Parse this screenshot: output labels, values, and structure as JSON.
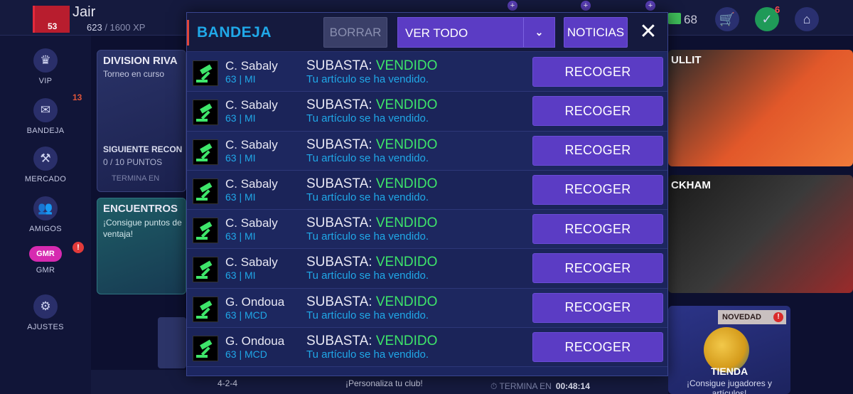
{
  "player": {
    "name": "Jair",
    "level": "53",
    "xp_current": "623",
    "xp_total": "1600",
    "xp_unit": "XP"
  },
  "currency": {
    "value": "68"
  },
  "header_icons": {
    "notifications_badge": "6"
  },
  "sidebar": {
    "items": [
      {
        "label": "VIP",
        "icon": "crown-icon"
      },
      {
        "label": "BANDEJA",
        "icon": "mail-icon",
        "badge": "13"
      },
      {
        "label": "MERCADO",
        "icon": "gavel-icon"
      },
      {
        "label": "AMIGOS",
        "icon": "friends-icon"
      },
      {
        "label": "GMR",
        "icon": "gmr-icon",
        "pill": "GMR",
        "alert": "!"
      },
      {
        "label": "AJUSTES",
        "icon": "gear-icon"
      }
    ]
  },
  "background": {
    "division": {
      "title": "DIVISION RIVA",
      "subtitle": "Torneo en curso",
      "next": "SIGUIENTE RECON",
      "points": "0 / 10 PUNTOS",
      "ends": "TERMINA EN"
    },
    "encuentros": {
      "title": "ENCUENTROS",
      "desc": "¡Consigue puntos de ventaja!"
    },
    "right_card_1": {
      "title": "ULLIT"
    },
    "right_card_2": {
      "title": "CKHAM"
    },
    "tienda": {
      "tag": "NOVEDAD",
      "title": "TIENDA",
      "subtitle": "¡Consigue jugadores y artículos!"
    },
    "bottom": {
      "formation": "4-2-4",
      "personaliza": "¡Personaliza tu club!",
      "timer_label": "TERMINA EN",
      "timer_value": "00:48:14"
    }
  },
  "modal": {
    "title": "BANDEJA",
    "borrar_label": "BORRAR",
    "filter_value": "VER TODO",
    "noticias_label": "NOTICIAS",
    "close_symbol": "✕",
    "subasta_prefix": "SUBASTA: ",
    "rows": [
      {
        "player": "C. Sabaly",
        "info": "63 | MI",
        "status": "VENDIDO",
        "message": "Tu artículo se ha vendido.",
        "action": "RECOGER"
      },
      {
        "player": "C. Sabaly",
        "info": "63 | MI",
        "status": "VENDIDO",
        "message": "Tu artículo se ha vendido.",
        "action": "RECOGER"
      },
      {
        "player": "C. Sabaly",
        "info": "63 | MI",
        "status": "VENDIDO",
        "message": "Tu artículo se ha vendido.",
        "action": "RECOGER"
      },
      {
        "player": "C. Sabaly",
        "info": "63 | MI",
        "status": "VENDIDO",
        "message": "Tu artículo se ha vendido.",
        "action": "RECOGER"
      },
      {
        "player": "C. Sabaly",
        "info": "63 | MI",
        "status": "VENDIDO",
        "message": "Tu artículo se ha vendido.",
        "action": "RECOGER"
      },
      {
        "player": "C. Sabaly",
        "info": "63 | MI",
        "status": "VENDIDO",
        "message": "Tu artículo se ha vendido.",
        "action": "RECOGER"
      },
      {
        "player": "G. Ondoua",
        "info": "63 | MCD",
        "status": "VENDIDO",
        "message": "Tu artículo se ha vendido.",
        "action": "RECOGER"
      },
      {
        "player": "G. Ondoua",
        "info": "63 | MCD",
        "status": "VENDIDO",
        "message": "Tu artículo se ha vendido.",
        "action": "RECOGER"
      }
    ]
  },
  "colors": {
    "accent_blue": "#20a8e8",
    "status_green": "#3ee66a",
    "button_purple": "#5b3cc4",
    "modal_bg": "#1c2660"
  }
}
